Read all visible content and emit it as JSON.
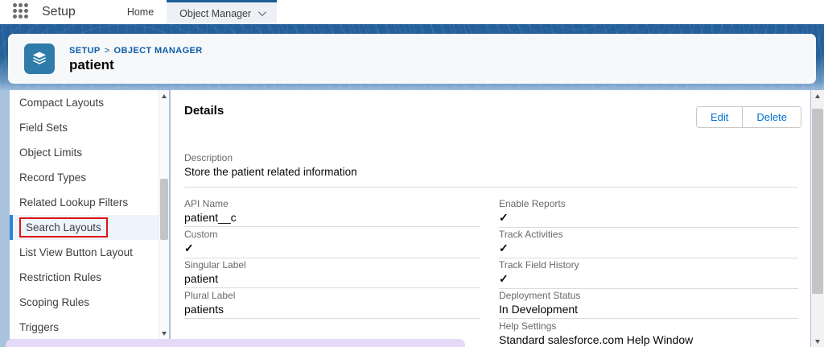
{
  "topbar": {
    "app_label": "Setup",
    "tabs": [
      {
        "label": "Home"
      },
      {
        "label": "Object Manager"
      }
    ]
  },
  "header": {
    "breadcrumb_parts": [
      "SETUP",
      "OBJECT MANAGER"
    ],
    "breadcrumb_separator": ">",
    "title": "patient"
  },
  "sidebar": {
    "items": [
      {
        "label": "Compact Layouts"
      },
      {
        "label": "Field Sets"
      },
      {
        "label": "Object Limits"
      },
      {
        "label": "Record Types"
      },
      {
        "label": "Related Lookup Filters"
      },
      {
        "label": "Search Layouts",
        "selected": true,
        "annotated": true
      },
      {
        "label": "List View Button Layout"
      },
      {
        "label": "Restriction Rules"
      },
      {
        "label": "Scoping Rules"
      },
      {
        "label": "Triggers"
      }
    ]
  },
  "main": {
    "section_title": "Details",
    "edit_label": "Edit",
    "delete_label": "Delete",
    "description": {
      "label": "Description",
      "value": "Store the patient related information"
    },
    "fields_left": [
      {
        "label": "API Name",
        "value": "patient__c"
      },
      {
        "label": "Custom",
        "value": "✓"
      },
      {
        "label": "Singular Label",
        "value": "patient"
      },
      {
        "label": "Plural Label",
        "value": "patients"
      }
    ],
    "fields_right": [
      {
        "label": "Enable Reports",
        "value": "✓"
      },
      {
        "label": "Track Activities",
        "value": "✓"
      },
      {
        "label": "Track Field History",
        "value": "✓"
      },
      {
        "label": "Deployment Status",
        "value": "In Development"
      },
      {
        "label": "Help Settings",
        "value": "Standard salesforce.com Help Window"
      }
    ]
  },
  "colors": {
    "banner_blue": "#235f99",
    "accent_blue": "#0070d2",
    "breadcrumb_blue": "#0b5cab",
    "selected_item_bg": "#eef4fb",
    "selected_item_border": "#2e84d5",
    "annotation_red": "#e01212",
    "annotation_lavender": "#e6d9f7",
    "object_icon_bg": "#2f7cab"
  }
}
